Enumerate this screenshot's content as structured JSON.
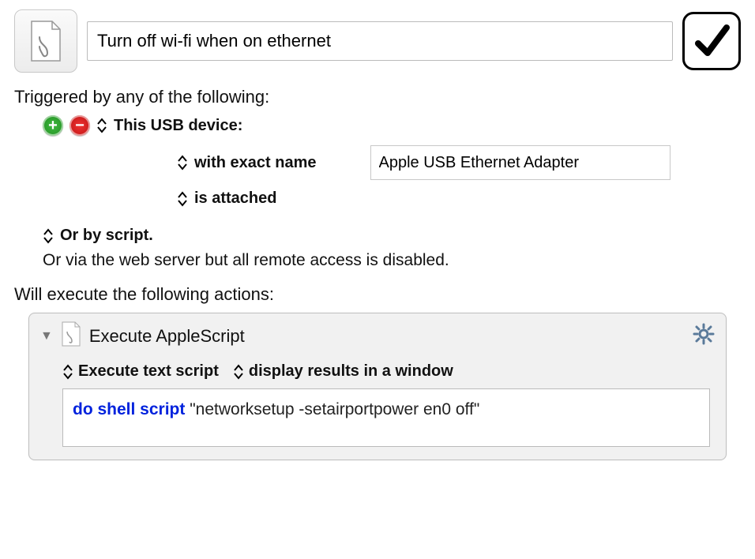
{
  "header": {
    "macro_name": "Turn off wi-fi when on ethernet"
  },
  "triggers": {
    "section_label": "Triggered by any of the following:",
    "type_label": "This USB device:",
    "match_mode": "with exact name",
    "device_name": "Apple USB Ethernet Adapter",
    "state": "is attached",
    "or_script": "Or by script.",
    "remote_note": "Or via the web server but all remote access is disabled."
  },
  "actions": {
    "section_label": "Will execute the following actions:",
    "title": "Execute AppleScript",
    "mode": "Execute text script",
    "results_mode": "display results in a window",
    "script_keyword": "do shell script",
    "script_arg": "\"networksetup -setairportpower en0 off\""
  }
}
